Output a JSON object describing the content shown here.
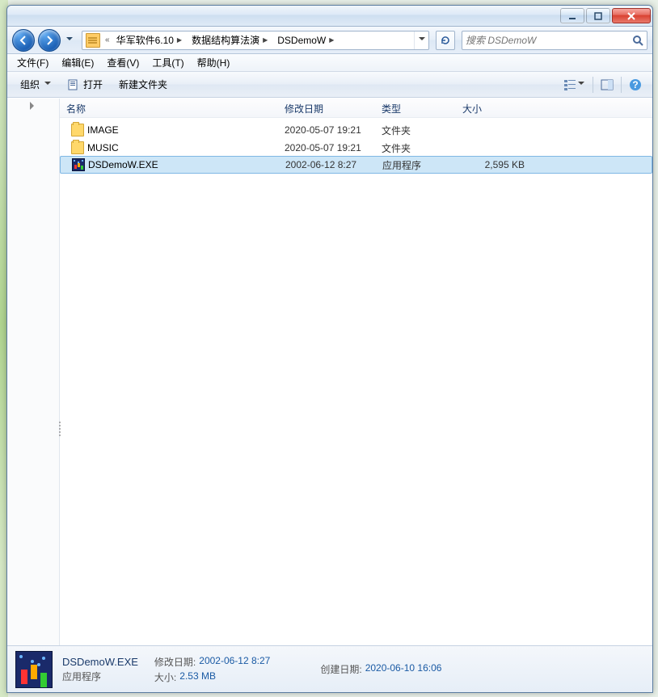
{
  "titlebar": {
    "minimize": "minimize",
    "maximize": "maximize",
    "close": "close"
  },
  "breadcrumb": {
    "prefix": "«",
    "items": [
      "华军软件6.10",
      "数据结构算法演",
      "DSDemoW"
    ]
  },
  "search": {
    "placeholder": "搜索 DSDemoW"
  },
  "menu": {
    "file": "文件(F)",
    "edit": "编辑(E)",
    "view": "查看(V)",
    "tools": "工具(T)",
    "help": "帮助(H)"
  },
  "toolbar": {
    "organize": "组织",
    "open": "打开",
    "newfolder": "新建文件夹"
  },
  "columns": {
    "name": "名称",
    "date": "修改日期",
    "type": "类型",
    "size": "大小"
  },
  "rows": [
    {
      "name": "IMAGE",
      "date": "2020-05-07 19:21",
      "type": "文件夹",
      "size": "",
      "icon": "folder",
      "selected": false
    },
    {
      "name": "MUSIC",
      "date": "2020-05-07 19:21",
      "type": "文件夹",
      "size": "",
      "icon": "folder",
      "selected": false
    },
    {
      "name": "DSDemoW.EXE",
      "date": "2002-06-12 8:27",
      "type": "应用程序",
      "size": "2,595 KB",
      "icon": "exe",
      "selected": true
    }
  ],
  "details": {
    "name": "DSDemoW.EXE",
    "type": "应用程序",
    "modified_label": "修改日期:",
    "modified_value": "2002-06-12 8:27",
    "size_label": "大小:",
    "size_value": "2.53 MB",
    "created_label": "创建日期:",
    "created_value": "2020-06-10 16:06"
  }
}
